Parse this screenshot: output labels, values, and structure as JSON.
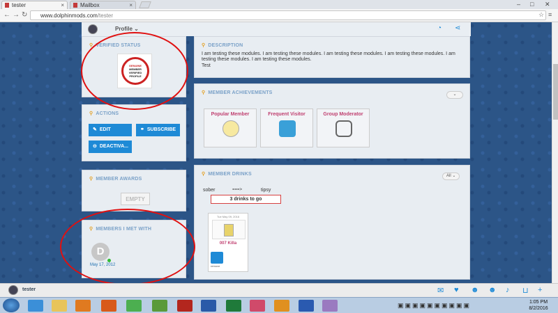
{
  "browser": {
    "tabs": [
      {
        "label": "tester"
      },
      {
        "label": "Mailbox"
      }
    ],
    "url": {
      "domain": "www.dolphinmods.com",
      "path": "/tester"
    }
  },
  "profile_bar": {
    "menu_label": "Profile"
  },
  "verified": {
    "title": "VERIFIED STATUS",
    "stamp_lines": [
      "GENUINE",
      "MEMBER",
      "VERIFIED",
      "PROFILE"
    ]
  },
  "actions": {
    "title": "ACTIONS",
    "edit": "EDIT",
    "subscribe": "SUBSCRIBE",
    "deactivate": "DEACTIVA..."
  },
  "awards": {
    "title": "MEMBER AWARDS",
    "empty": "EMPTY"
  },
  "met": {
    "title": "MEMBERS I MET WITH",
    "avatar_letter": "D",
    "date": "May 17, 2012"
  },
  "description": {
    "title": "DESCRIPTION",
    "text": "I am testing these modules. I am testing these modules. I am testing these modules. I am testing these modules. I am testing these modules. I am testing these modules.",
    "extra": "Test"
  },
  "achievements": {
    "title": "MEMBER ACHIEVEMENTS",
    "items": [
      {
        "label": "Popular Member"
      },
      {
        "label": "Frequent Visitor"
      },
      {
        "label": "Group Moderator"
      }
    ]
  },
  "drinks": {
    "title": "MEMBER DRINKS",
    "filter": "All",
    "scale_left": "sober",
    "arrow": "===>",
    "scale_right": "tipsy",
    "progress_text": "3 drinks to go",
    "card_date": "Tue May 09, 2016",
    "card_name": "007 Killa",
    "remove": "remove"
  },
  "footer": {
    "user": "tester"
  },
  "taskbar": {
    "time": "1:05 PM",
    "date": "8/2/2016"
  },
  "colors": {
    "accent": "#1e8ad6",
    "title_blue": "#7aa1c8",
    "achievement_pink": "#c04070",
    "annotation_red": "#e01010"
  }
}
